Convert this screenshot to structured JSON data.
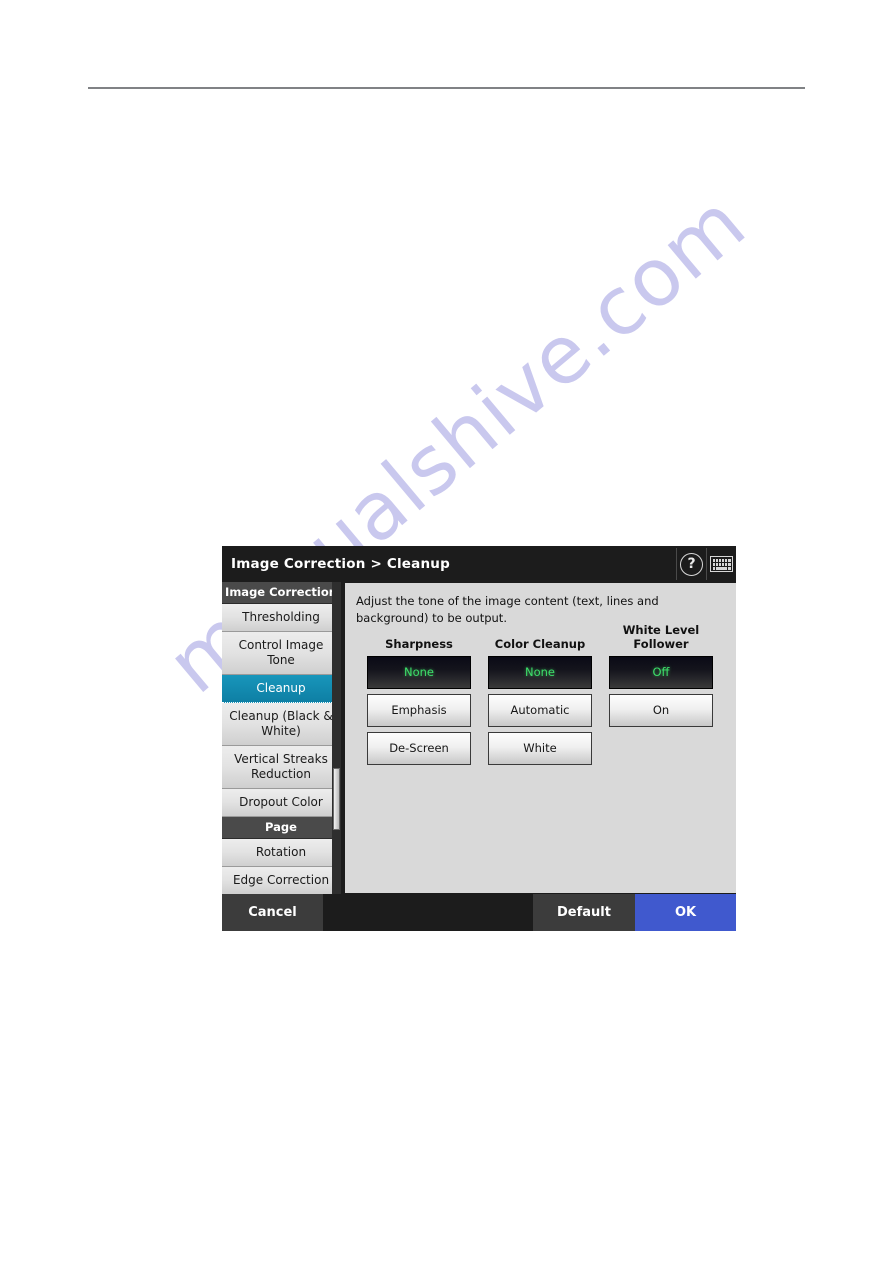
{
  "page": {
    "watermark": "manualshive.com"
  },
  "dialog": {
    "title": "Image Correction > Cleanup",
    "icons": {
      "help": "help-icon",
      "keyboard": "keyboard-icon"
    },
    "sidebar": {
      "groups": [
        {
          "label": "Image Correction",
          "items": [
            {
              "label": "Thresholding",
              "selected": false
            },
            {
              "label": "Control Image Tone",
              "selected": false
            },
            {
              "label": "Cleanup",
              "selected": true
            },
            {
              "label": "Cleanup (Black & White)",
              "selected": false
            },
            {
              "label": "Vertical Streaks Reduction",
              "selected": false
            },
            {
              "label": "Dropout Color",
              "selected": false
            }
          ]
        },
        {
          "label": "Page",
          "items": [
            {
              "label": "Rotation",
              "selected": false
            },
            {
              "label": "Edge Correction",
              "selected": false
            }
          ]
        }
      ]
    },
    "content": {
      "description": "Adjust the tone of the image content (text, lines and background) to be output.",
      "groups": [
        {
          "title": "Sharpness",
          "options": [
            {
              "label": "None",
              "selected": true
            },
            {
              "label": "Emphasis",
              "selected": false
            },
            {
              "label": "De-Screen",
              "selected": false
            }
          ]
        },
        {
          "title": "Color Cleanup",
          "options": [
            {
              "label": "None",
              "selected": true
            },
            {
              "label": "Automatic",
              "selected": false
            },
            {
              "label": "White",
              "selected": false
            }
          ]
        },
        {
          "title": "White Level Follower",
          "options": [
            {
              "label": "Off",
              "selected": true
            },
            {
              "label": "On",
              "selected": false
            }
          ]
        }
      ]
    },
    "buttons": {
      "cancel": "Cancel",
      "default": "Default",
      "ok": "OK"
    }
  },
  "colors": {
    "titlebar": "#1c1c1c",
    "selected_sidebar": "#0e7fa4",
    "selected_option_text": "#3ddf6a",
    "ok_button": "#4059ce",
    "watermark": "#c9c8ee"
  }
}
